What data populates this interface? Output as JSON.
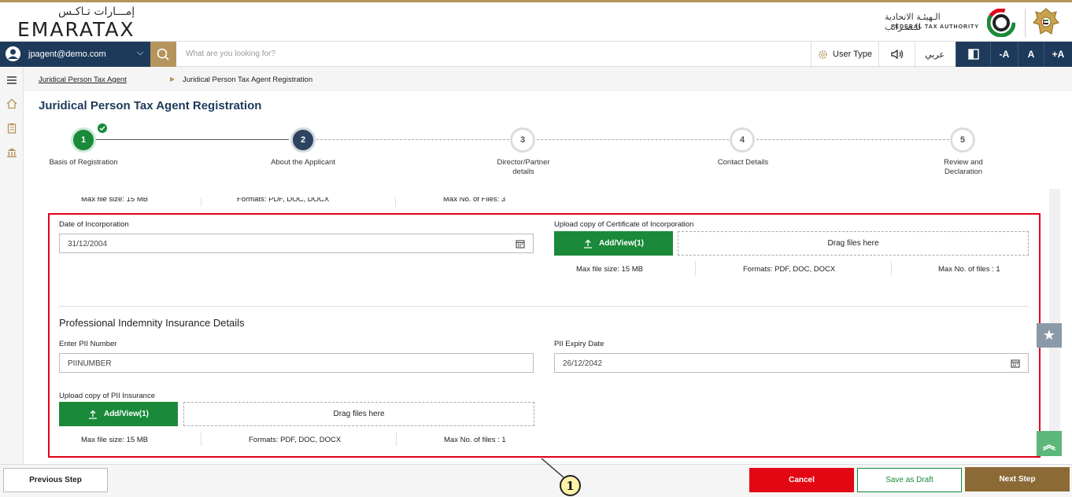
{
  "header": {
    "logo_ar": "إمـــارات تـاكـس",
    "logo_en": "EMARATAX",
    "fta_ar": "الـهيئـة الاتحادية للـضـرائب",
    "fta_en": "FEDERAL TAX AUTHORITY"
  },
  "navbar": {
    "user_email": "jpagent@demo.com",
    "search_placeholder": "What are you looking for?",
    "user_type": "User Type",
    "arabic": "عربي",
    "font_minus": "-A",
    "font_normal": "A",
    "font_plus": "+A"
  },
  "breadcrumb": {
    "parent": "Juridical Person Tax Agent",
    "current": "Juridical Person Tax Agent Registration"
  },
  "page_title": "Juridical Person Tax Agent Registration",
  "steps": [
    {
      "number": "1",
      "label": "Basis of Registration",
      "status": "done"
    },
    {
      "number": "2",
      "label": "About the Applicant",
      "status": "active"
    },
    {
      "number": "3",
      "label": "Director/Partner details",
      "status": "todo"
    },
    {
      "number": "4",
      "label": "Contact Details",
      "status": "todo"
    },
    {
      "number": "5",
      "label": "Review and Declaration",
      "status": "todo"
    }
  ],
  "partial_row": {
    "max_size": "Max file size: 15 MB",
    "formats": "Formats: PDF, DOC, DOCX",
    "max_files": "Max No. of Files: 3"
  },
  "incorporation": {
    "date_label": "Date of Incorporation",
    "date_value": "31/12/2004",
    "upload_label": "Upload copy of Certificate of Incorporation",
    "add_view": "Add/View(1)",
    "drag": "Drag files here",
    "max_size": "Max file size: 15 MB",
    "formats": "Formats: PDF, DOC, DOCX",
    "max_files": "Max No. of files : 1"
  },
  "pii": {
    "section_title": "Professional Indemnity Insurance Details",
    "number_label": "Enter PII Number",
    "number_value": "PIINUMBER",
    "expiry_label": "PII Expiry Date",
    "expiry_value": "26/12/2042",
    "upload_label": "Upload copy of PII Insurance",
    "add_view": "Add/View(1)",
    "drag": "Drag files here",
    "max_size": "Max file size: 15 MB",
    "formats": "Formats: PDF, DOC, DOCX",
    "max_files": "Max No. of files : 1"
  },
  "footer": {
    "previous": "Previous Step",
    "cancel": "Cancel",
    "save_draft": "Save as Draft",
    "next": "Next Step"
  },
  "annotation": {
    "callout": "1"
  },
  "colors": {
    "navy": "#1e3a5a",
    "gold": "#b5955b",
    "green": "#1a8a3a",
    "red": "#e0001b",
    "cancel_red": "#e30613",
    "next_brown": "#8b6a35"
  }
}
